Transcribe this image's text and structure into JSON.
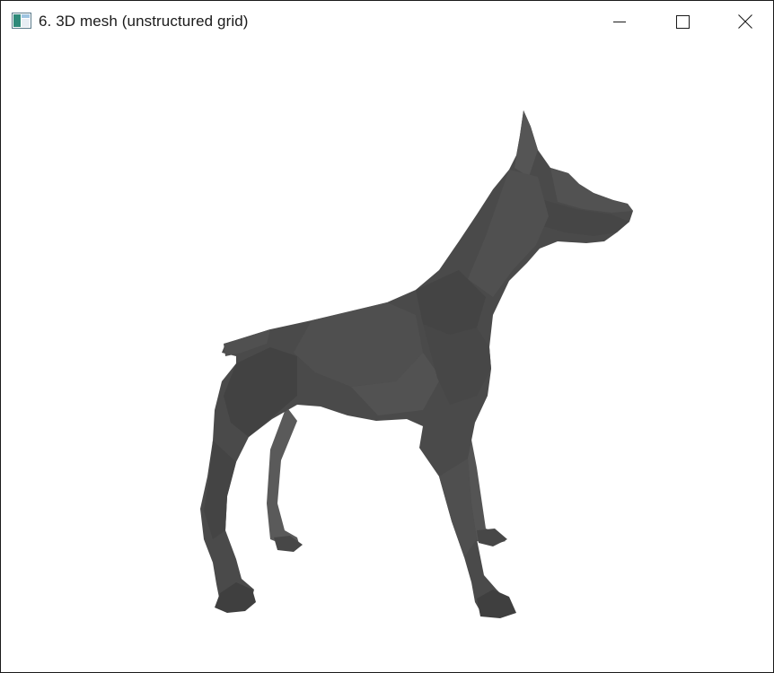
{
  "window": {
    "title": "6. 3D mesh (unstructured grid)",
    "icon": "app-window-icon"
  },
  "controls": {
    "minimize_icon": "minimize-icon",
    "maximize_icon": "maximize-icon",
    "close_icon": "close-icon"
  },
  "scene": {
    "object": "dog-mesh",
    "mesh_color": "#4a4a4a",
    "background_color": "#ffffff"
  }
}
